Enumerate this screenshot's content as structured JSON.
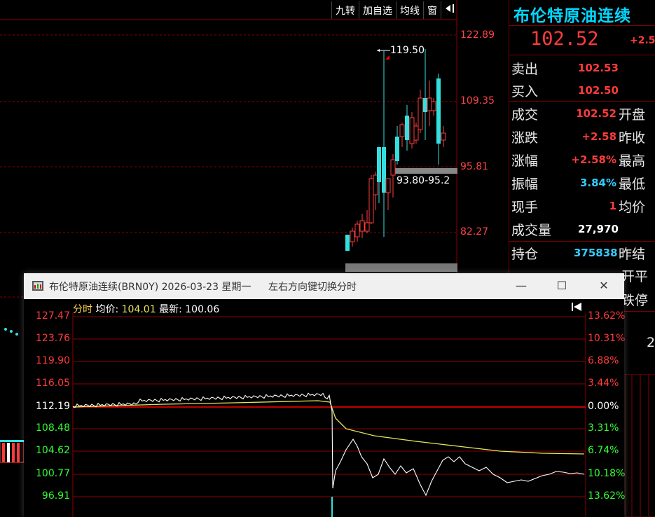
{
  "toolbar": {
    "items": [
      "九转",
      "加自选",
      "均线",
      "窗"
    ],
    "exit_icon": "exit-arrow-icon"
  },
  "main_chart": {
    "price_axis": [
      "122.89",
      "109.35",
      "95.81",
      "82.27"
    ],
    "high_marker": "119.50",
    "range_label": "93.80-95.2"
  },
  "quote": {
    "title": "布伦特原油连续",
    "price": "102.52",
    "change_short": "+2.5",
    "rows": [
      {
        "label": "卖出",
        "value": "102.53",
        "color": "#ff3b3b",
        "label2": ""
      },
      {
        "label": "买入",
        "value": "102.50",
        "color": "#ff3b3b",
        "label2": ""
      },
      {
        "label": "成交",
        "value": "102.52",
        "color": "#ff3b3b",
        "label2": "开盘"
      },
      {
        "label": "涨跌",
        "value": "+2.58",
        "color": "#ff3b3b",
        "label2": "昨收"
      },
      {
        "label": "涨幅",
        "value": "+2.58%",
        "color": "#ff3b3b",
        "label2": "最高"
      },
      {
        "label": "振幅",
        "value": "3.84%",
        "color": "#33ccff",
        "label2": "最低"
      },
      {
        "label": "现手",
        "value": "1",
        "color": "#ff3b3b",
        "label2": "均价"
      },
      {
        "label": "成交量",
        "value": "27,970",
        "color": "#ffffff",
        "label2": ""
      },
      {
        "label": "持仓",
        "value": "375838",
        "color": "#33ccff",
        "label2": "昨结"
      }
    ],
    "partial_right": [
      "开平",
      "跌停",
      "2"
    ]
  },
  "popup": {
    "title": "布伦特原油连续(BRN0Y) 2026-03-23 星期一",
    "hint": "左右方向键切换分时",
    "minimize": "—",
    "maximize": "☐",
    "close": "✕",
    "header_mode": "分时",
    "header_avg_label": "均价:",
    "header_avg_value": "104.01",
    "header_latest_label": "最新:",
    "header_latest_value": "100.06",
    "left_axis": [
      "127.47",
      "123.76",
      "119.90",
      "116.05",
      "112.19",
      "108.48",
      "104.62",
      "100.77",
      "96.91"
    ],
    "right_axis": [
      "13.62%",
      "10.31%",
      "6.88%",
      "3.44%",
      "0.00%",
      "3.31%",
      "6.74%",
      "10.18%",
      "13.62%"
    ]
  },
  "colors": {
    "up": "#ff3b3b",
    "down": "#33e0e0",
    "grid": "#8b0000",
    "avg_line": "#e6e65a"
  }
}
